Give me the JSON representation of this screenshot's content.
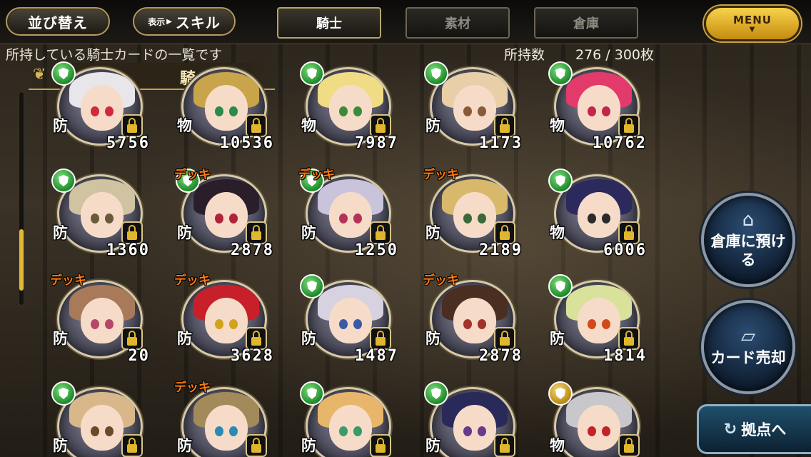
{
  "header": {
    "sort_label": "並び替え",
    "display_prefix": "表示",
    "display_value": "スキル",
    "tabs": [
      {
        "label": "騎士",
        "active": true
      },
      {
        "label": "素材",
        "active": false
      },
      {
        "label": "倉庫",
        "active": false
      }
    ],
    "menu_label": "MENU"
  },
  "info": {
    "description": "所持している騎士カードの一覧です",
    "count_label": "所持数",
    "count_value": "276 / 300枚"
  },
  "section": {
    "title": "騎士"
  },
  "scroll": {
    "position_fraction": 0.64
  },
  "cards": [
    {
      "type": "防",
      "power": "5756",
      "deck": "",
      "shield": "green",
      "hair": "#e8e6ea",
      "eyes": "#d22a3a"
    },
    {
      "type": "物",
      "power": "10536",
      "deck": "",
      "shield": "none",
      "hair": "#c8a44a",
      "eyes": "#2c8a4a"
    },
    {
      "type": "物",
      "power": "7987",
      "deck": "",
      "shield": "green",
      "hair": "#f1dc86",
      "eyes": "#3c8a3c"
    },
    {
      "type": "防",
      "power": "1173",
      "deck": "",
      "shield": "green",
      "hair": "#e8cfa8",
      "eyes": "#8a5a3a"
    },
    {
      "type": "物",
      "power": "10762",
      "deck": "",
      "shield": "green",
      "hair": "#e23a6a",
      "eyes": "#c2264a"
    },
    {
      "type": "防",
      "power": "1360",
      "deck": "",
      "shield": "green",
      "hair": "#cfc3a2",
      "eyes": "#6a5a3a"
    },
    {
      "type": "防",
      "power": "2878",
      "deck": "デッキ",
      "shield": "green",
      "hair": "#2a1e2a",
      "eyes": "#b0233a"
    },
    {
      "type": "防",
      "power": "1250",
      "deck": "デッキ",
      "shield": "green",
      "hair": "#c9c4dc",
      "eyes": "#b4325a"
    },
    {
      "type": "防",
      "power": "2189",
      "deck": "デッキ",
      "shield": "none",
      "hair": "#d8b86a",
      "eyes": "#3a6a3a"
    },
    {
      "type": "物",
      "power": "6006",
      "deck": "",
      "shield": "green",
      "hair": "#2c2a5c",
      "eyes": "#2c2a2a"
    },
    {
      "type": "防",
      "power": "20",
      "deck": "デッキ",
      "shield": "none",
      "hair": "#a87a5a",
      "eyes": "#b4486a"
    },
    {
      "type": "防",
      "power": "3628",
      "deck": "デッキ",
      "shield": "none",
      "hair": "#c8202a",
      "eyes": "#d2a21a"
    },
    {
      "type": "防",
      "power": "1487",
      "deck": "",
      "shield": "green",
      "hair": "#d6d2e0",
      "eyes": "#3a5aa4"
    },
    {
      "type": "防",
      "power": "2878",
      "deck": "デッキ",
      "shield": "none",
      "hair": "#4a2e22",
      "eyes": "#a2322a"
    },
    {
      "type": "防",
      "power": "1814",
      "deck": "",
      "shield": "green",
      "hair": "#d8e29a",
      "eyes": "#d24a1a"
    },
    {
      "type": "防",
      "power": "",
      "deck": "",
      "shield": "green",
      "hair": "#d8b88a",
      "eyes": "#6a4a2a"
    },
    {
      "type": "防",
      "power": "",
      "deck": "デッキ",
      "shield": "none",
      "hair": "#a28a5a",
      "eyes": "#2a8ab4"
    },
    {
      "type": "防",
      "power": "",
      "deck": "",
      "shield": "green",
      "hair": "#e8b66a",
      "eyes": "#3a9a6a"
    },
    {
      "type": "防",
      "power": "",
      "deck": "",
      "shield": "green",
      "hair": "#2a2a5a",
      "eyes": "#6a3a8a"
    },
    {
      "type": "物",
      "power": "",
      "deck": "",
      "shield": "gold",
      "hair": "#c8c8cc",
      "eyes": "#c2222a"
    }
  ],
  "side_buttons": {
    "store_label": "倉庫に預ける",
    "store_icon": "house-icon",
    "sell_label": "カード売却",
    "sell_icon": "card-icon",
    "base_label": "拠点へ",
    "base_icon": "return-arrow-icon"
  },
  "colors": {
    "gold": "#c9a24a",
    "deck_orange": "#ff7a12",
    "menu_yellow": "#f7d34a"
  }
}
